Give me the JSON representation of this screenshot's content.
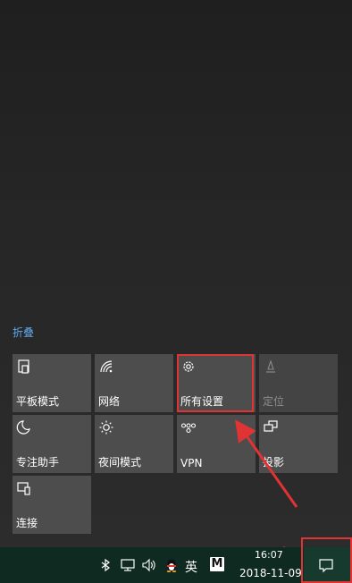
{
  "action_center": {
    "collapse_label": "折叠",
    "tiles": [
      {
        "label": "平板模式",
        "icon": "tablet-mode-icon",
        "enabled": true
      },
      {
        "label": "网络",
        "icon": "network-icon",
        "enabled": true
      },
      {
        "label": "所有设置",
        "icon": "settings-gear-icon",
        "enabled": true
      },
      {
        "label": "定位",
        "icon": "location-icon",
        "enabled": false
      },
      {
        "label": "专注助手",
        "icon": "moon-icon",
        "enabled": true
      },
      {
        "label": "夜间模式",
        "icon": "brightness-icon",
        "enabled": true
      },
      {
        "label": "VPN",
        "icon": "vpn-icon",
        "enabled": true
      },
      {
        "label": "投影",
        "icon": "project-icon",
        "enabled": true
      },
      {
        "label": "连接",
        "icon": "connect-icon",
        "enabled": true
      }
    ]
  },
  "taskbar": {
    "ime_label": "英",
    "m_label": "M",
    "time": "16:07",
    "date": "2018-11-09"
  },
  "colors": {
    "accent_link": "#5fa8e8",
    "annotation_red": "#e03333",
    "taskbar_bg": "#0f2a21"
  }
}
